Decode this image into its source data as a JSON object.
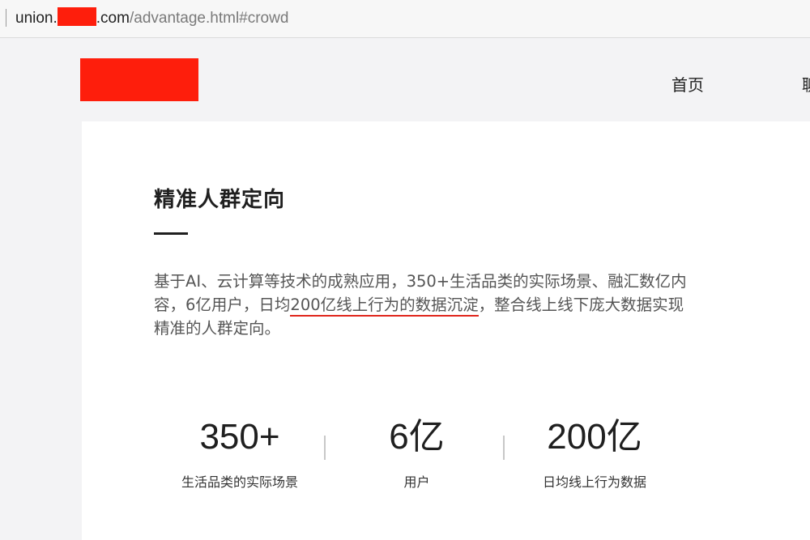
{
  "browser": {
    "url_prefix": "union.",
    "url_suffix": ".com",
    "url_path": "/advantage.html#crowd"
  },
  "header": {
    "nav": [
      {
        "label": "首页"
      },
      {
        "label": "聊"
      }
    ]
  },
  "section": {
    "title": "精准人群定向",
    "desc_before": "基于AI、云计算等技术的成熟应用，350+生活品类的实际场景、融汇数亿内容，6亿用户，日均",
    "desc_highlight": "200亿线上行为的数据沉淀",
    "desc_after": "，整合线上线下庞大数据实现精准的人群定向。"
  },
  "stats": [
    {
      "value": "350+",
      "label": "生活品类的实际场景"
    },
    {
      "value": "6亿",
      "label": "用户"
    },
    {
      "value": "200亿",
      "label": "日均线上行为数据"
    }
  ],
  "colors": {
    "redaction": "#fe1e0c",
    "underline": "#e0261c"
  }
}
